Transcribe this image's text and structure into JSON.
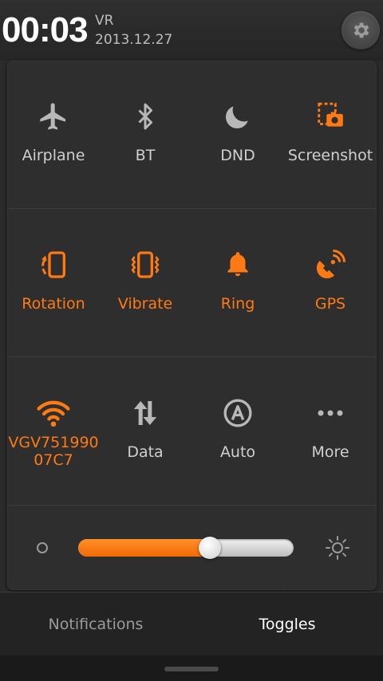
{
  "status": {
    "time": "00:03",
    "carrier": "VR",
    "date": "2013.12.27"
  },
  "colors": {
    "accent": "#ff7a12",
    "inactive": "#cfcfcf",
    "icon_inactive": "#b8b8b8"
  },
  "toggles": [
    {
      "label": "Airplane",
      "icon": "airplane-icon",
      "active": false
    },
    {
      "label": "BT",
      "icon": "bluetooth-icon",
      "active": false
    },
    {
      "label": "DND",
      "icon": "moon-icon",
      "active": false
    },
    {
      "label": "Screenshot",
      "icon": "screenshot-icon",
      "active": false
    },
    {
      "label": "Rotation",
      "icon": "rotation-icon",
      "active": true
    },
    {
      "label": "Vibrate",
      "icon": "vibrate-icon",
      "active": true
    },
    {
      "label": "Ring",
      "icon": "bell-icon",
      "active": true
    },
    {
      "label": "GPS",
      "icon": "gps-icon",
      "active": true
    },
    {
      "label_line1": "VGV751990",
      "label_line2": "07C7",
      "icon": "wifi-icon",
      "active": true
    },
    {
      "label": "Data",
      "icon": "data-arrows-icon",
      "active": false
    },
    {
      "label": "Auto",
      "icon": "auto-brightness-icon",
      "active": false
    },
    {
      "label": "More",
      "icon": "more-dots-icon",
      "active": false
    }
  ],
  "brightness": {
    "level": 0.61
  },
  "tabs": {
    "notifications": "Notifications",
    "toggles": "Toggles",
    "selected": "Toggles"
  }
}
